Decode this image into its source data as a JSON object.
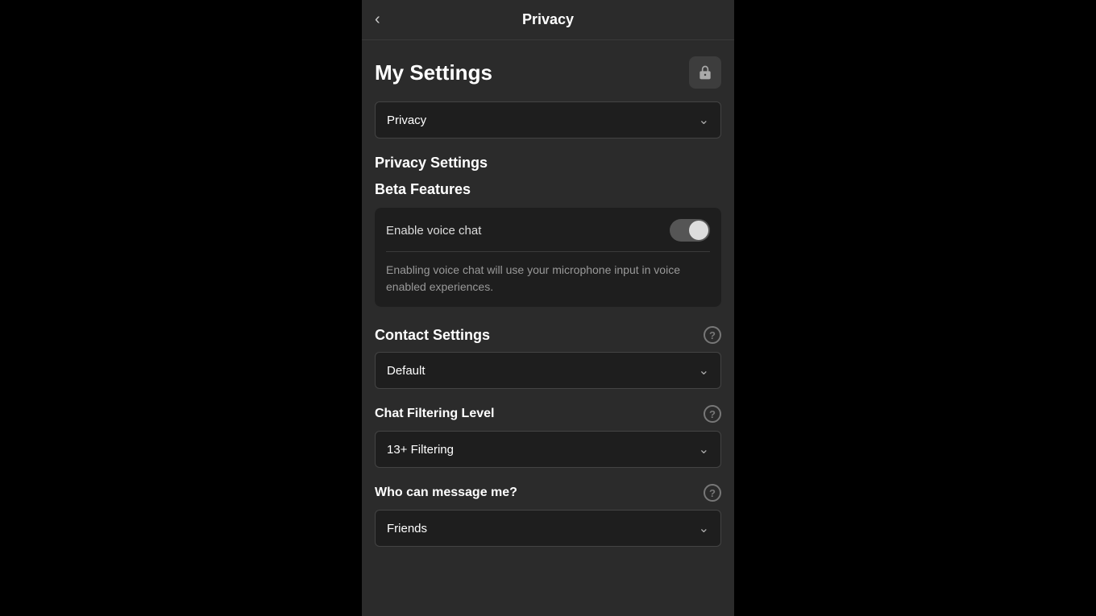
{
  "nav": {
    "back_label": "‹",
    "title": "Privacy"
  },
  "my_settings": {
    "title": "My Settings",
    "lock_icon": "lock"
  },
  "category_dropdown": {
    "value": "Privacy",
    "arrow": "⌄"
  },
  "privacy_settings": {
    "title": "Privacy Settings"
  },
  "beta_features": {
    "title": "Beta Features",
    "toggle_label": "Enable voice chat",
    "toggle_state": "on",
    "description": "Enabling voice chat will use your microphone input in voice enabled experiences."
  },
  "contact_settings": {
    "title": "Contact Settings",
    "help_label": "?",
    "dropdown_value": "Default",
    "dropdown_arrow": "⌄"
  },
  "chat_filtering": {
    "title": "Chat Filtering Level",
    "help_label": "?",
    "dropdown_value": "13+ Filtering",
    "dropdown_arrow": "⌄"
  },
  "who_can_message": {
    "title": "Who can message me?",
    "help_label": "?",
    "dropdown_value": "Friends",
    "dropdown_arrow": "⌄"
  }
}
